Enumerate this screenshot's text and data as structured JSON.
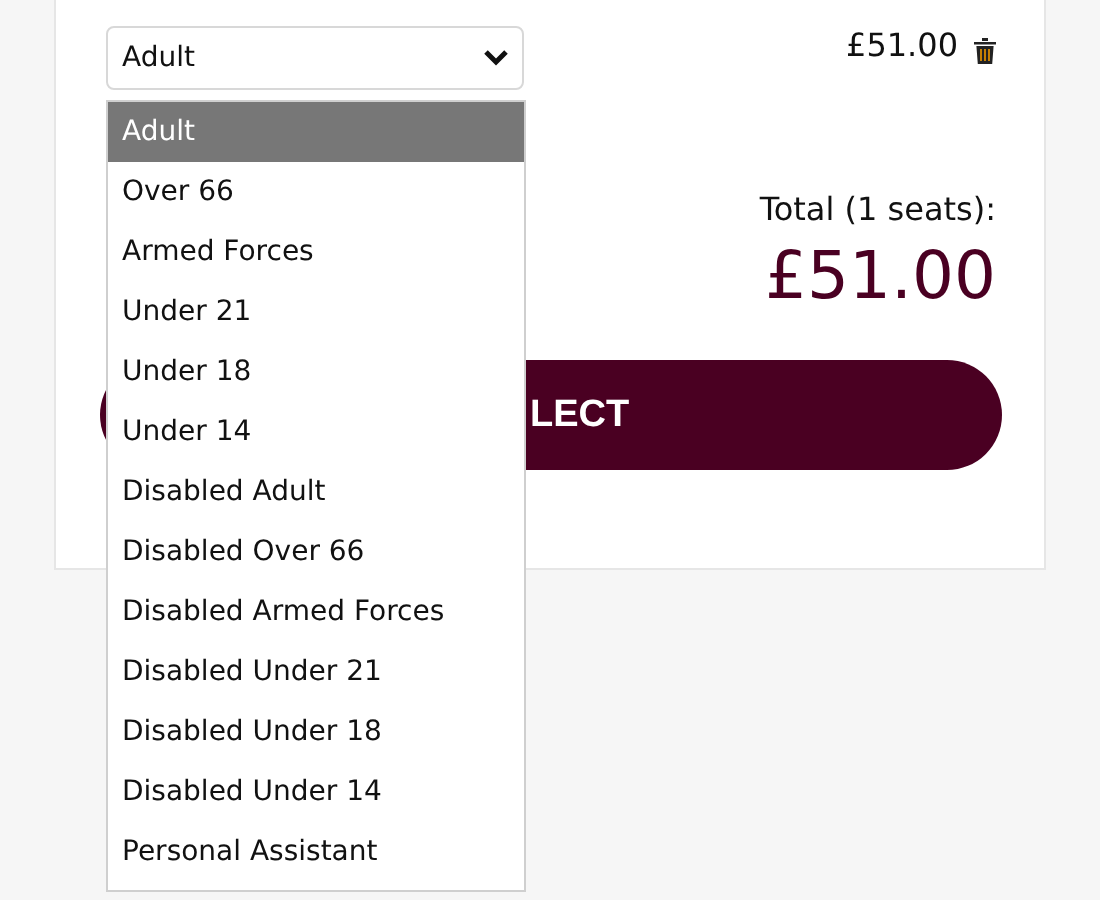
{
  "ticket_select": {
    "value": "Adult"
  },
  "price": "£51.00",
  "total_label": "Total (1 seats):",
  "total": "£51.00",
  "select_button": "LECT",
  "dropdown": [
    {
      "label": "Adult",
      "selected": true
    },
    {
      "label": "Over 66",
      "selected": false
    },
    {
      "label": "Armed Forces",
      "selected": false
    },
    {
      "label": "Under 21",
      "selected": false
    },
    {
      "label": "Under 18",
      "selected": false
    },
    {
      "label": "Under 14",
      "selected": false
    },
    {
      "label": "Disabled Adult",
      "selected": false
    },
    {
      "label": "Disabled Over 66",
      "selected": false
    },
    {
      "label": "Disabled Armed Forces",
      "selected": false
    },
    {
      "label": "Disabled Under 21",
      "selected": false
    },
    {
      "label": "Disabled Under 18",
      "selected": false
    },
    {
      "label": "Disabled Under 14",
      "selected": false
    },
    {
      "label": "Personal Assistant",
      "selected": false
    }
  ]
}
